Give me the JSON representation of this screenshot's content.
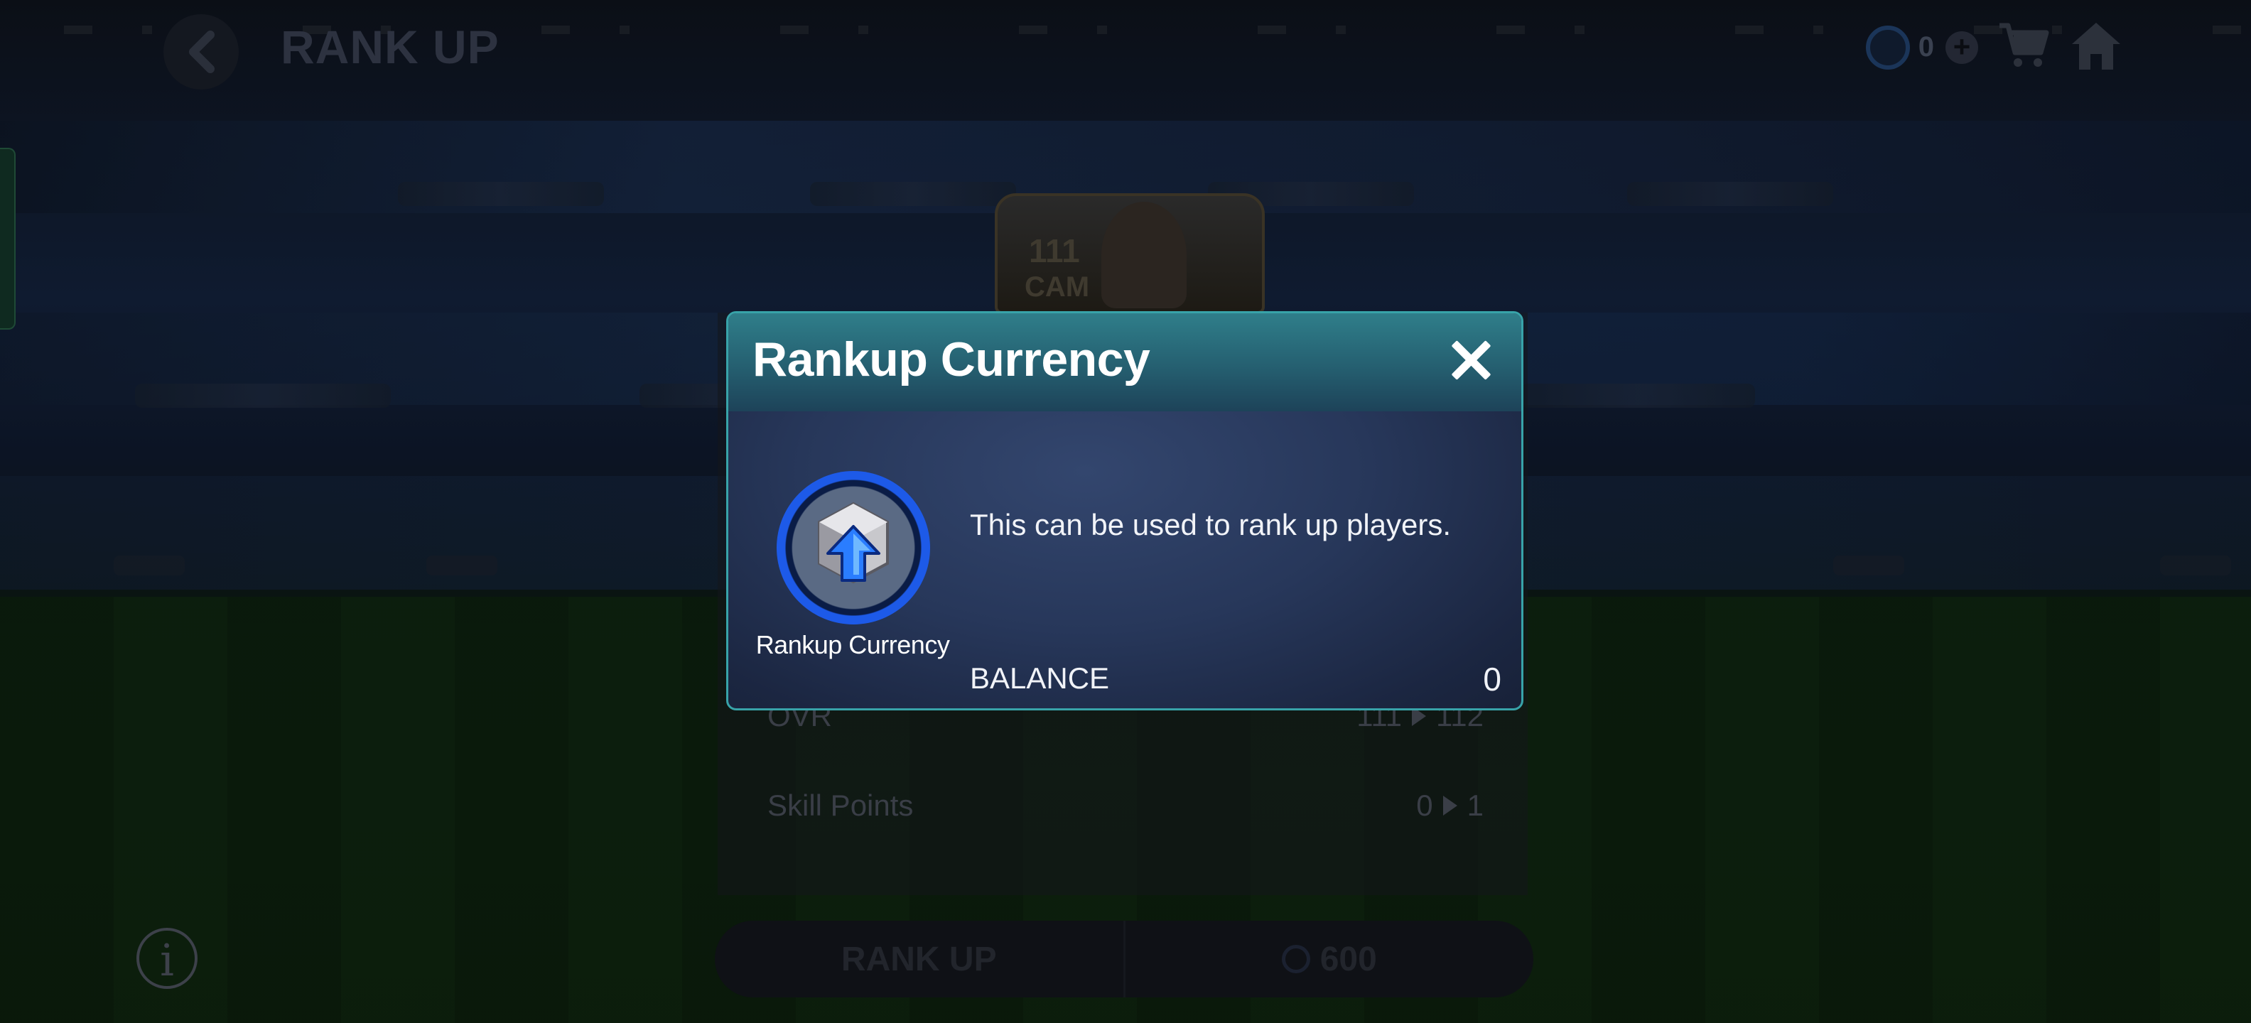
{
  "header": {
    "title": "RANK UP",
    "currency_value": "0"
  },
  "player_card": {
    "rating": "111",
    "position": "CAM"
  },
  "stats": [
    {
      "label": "OVR",
      "from": "111",
      "to": "112"
    },
    {
      "label": "Skill Points",
      "from": "0",
      "to": "1"
    }
  ],
  "rank_up_button": {
    "label": "RANK UP",
    "cost": "600"
  },
  "modal": {
    "title": "Rankup Currency",
    "icon_caption": "Rankup Currency",
    "description": "This can be used to rank up players.",
    "balance_label": "BALANCE",
    "balance_value": "0"
  },
  "colors": {
    "modal_border": "#38a3a9",
    "modal_header": "#2f7e8a",
    "modal_body": "#27375a",
    "currency_ring": "#1d5ae8"
  },
  "icons": [
    "back-icon",
    "currency-icon",
    "plus-icon",
    "cart-icon",
    "home-icon",
    "close-icon",
    "info-icon",
    "rankup-currency-icon"
  ]
}
